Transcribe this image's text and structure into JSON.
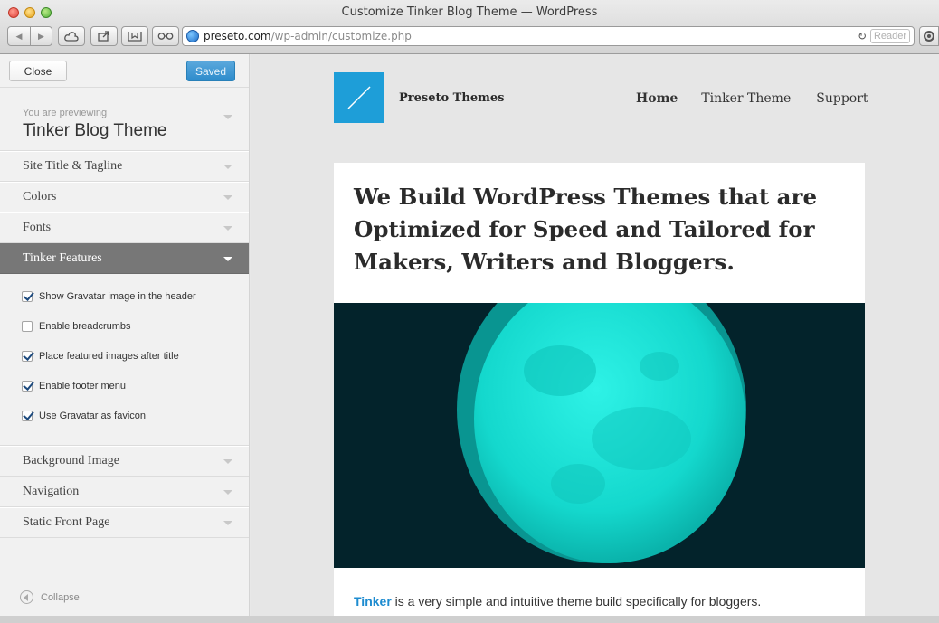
{
  "window": {
    "title": "Customize Tinker Blog Theme — WordPress",
    "url_domain": "preseto.com",
    "url_path": "/wp-admin/customize.php",
    "reader_label": "Reader"
  },
  "customizer": {
    "close_label": "Close",
    "saved_label": "Saved",
    "previewing_label": "You are previewing",
    "theme_name": "Tinker Blog Theme",
    "sections_top": [
      {
        "label": "Site Title & Tagline"
      },
      {
        "label": "Colors"
      },
      {
        "label": "Fonts"
      }
    ],
    "open_section": {
      "label": "Tinker Features"
    },
    "features": [
      {
        "label": "Show Gravatar image in the header",
        "checked": true
      },
      {
        "label": "Enable breadcrumbs",
        "checked": false
      },
      {
        "label": "Place featured images after title",
        "checked": true
      },
      {
        "label": "Enable footer menu",
        "checked": true
      },
      {
        "label": "Use Gravatar as favicon",
        "checked": true
      }
    ],
    "sections_bottom": [
      {
        "label": "Background Image"
      },
      {
        "label": "Navigation"
      },
      {
        "label": "Static Front Page"
      }
    ],
    "collapse_label": "Collapse"
  },
  "site": {
    "title": "Preseto Themes",
    "nav": {
      "home": "Home",
      "tinker": "Tinker Theme",
      "support": "Support"
    },
    "headline": "We Build WordPress Themes that are Optimized for Speed and Tailored for Makers, Writers and Bloggers.",
    "intro_link": "Tinker",
    "intro_text": " is a very simple and intuitive theme build specifically for bloggers."
  },
  "colors": {
    "accent_blue": "#1e9ed8",
    "saved_button": "#2e8ccc",
    "open_section_bg": "#777777",
    "hero_bg": "#03232b",
    "moon": "#18e0d6"
  }
}
